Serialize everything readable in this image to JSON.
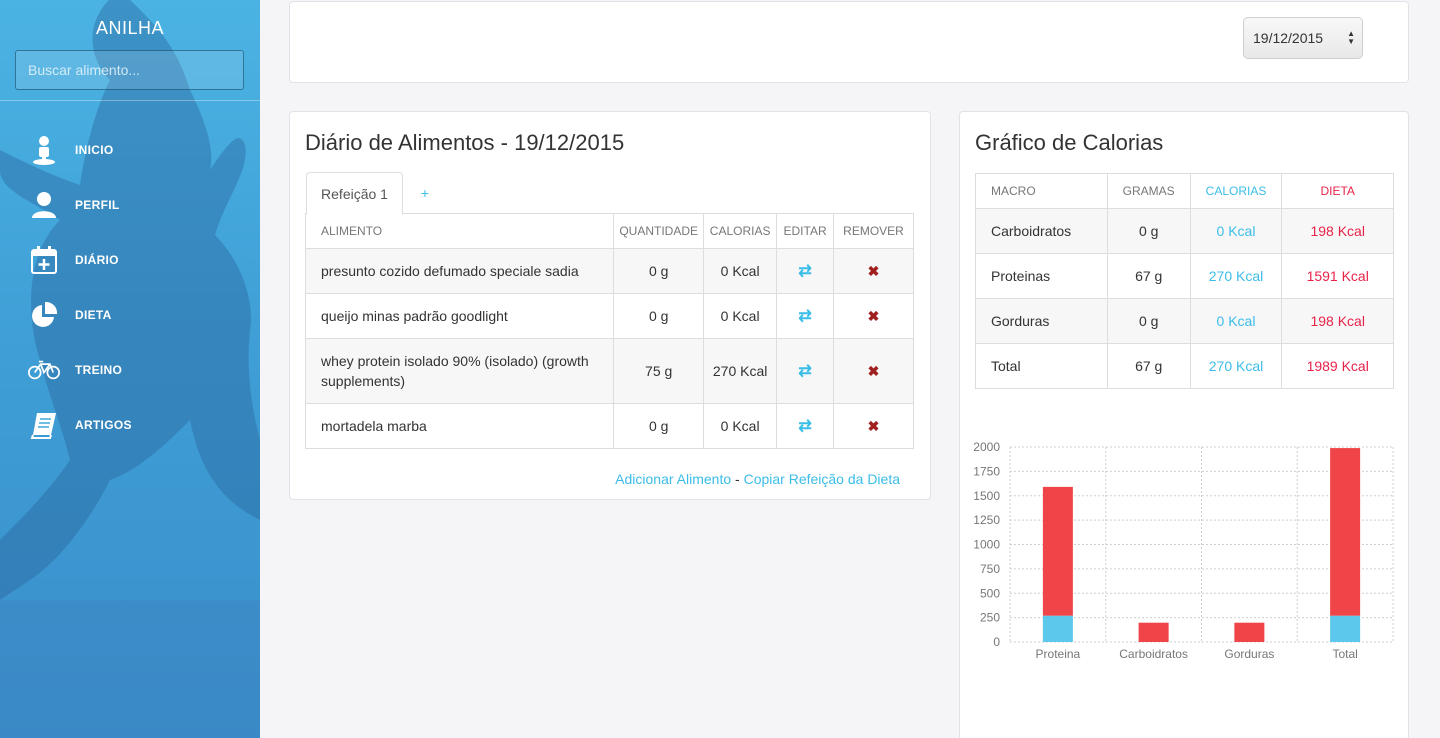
{
  "sidebar": {
    "brand": "ANILHA",
    "search_placeholder": "Buscar alimento...",
    "items": [
      {
        "label": "INICIO",
        "icon": "person-pin-icon"
      },
      {
        "label": "PERFIL",
        "icon": "user-icon"
      },
      {
        "label": "DIÁRIO",
        "icon": "calendar-add-icon"
      },
      {
        "label": "DIETA",
        "icon": "pie-chart-icon"
      },
      {
        "label": "TREINO",
        "icon": "bicycle-icon"
      },
      {
        "label": "ARTIGOS",
        "icon": "book-icon"
      }
    ]
  },
  "header": {
    "date_value": "19/12/2015"
  },
  "diary": {
    "title": "Diário de Alimentos - 19/12/2015",
    "tab_label": "Refeição 1",
    "tab_add": "+",
    "columns": [
      "ALIMENTO",
      "QUANTIDADE",
      "CALORIAS",
      "EDITAR",
      "REMOVER"
    ],
    "rows": [
      {
        "food": "presunto cozido defumado speciale sadia",
        "qty": "0 g",
        "cal": "0 Kcal"
      },
      {
        "food": "queijo minas padrão goodlight",
        "qty": "0 g",
        "cal": "0 Kcal"
      },
      {
        "food": "whey protein isolado 90% (isolado) (growth supplements)",
        "qty": "75 g",
        "cal": "270 Kcal"
      },
      {
        "food": "mortadela marba",
        "qty": "0 g",
        "cal": "0 Kcal"
      }
    ],
    "add_food_link": "Adicionar Alimento",
    "separator": "-",
    "copy_meal_link": "Copiar Refeição da Dieta"
  },
  "calories": {
    "title": "Gráfico de Calorias",
    "columns": [
      "MACRO",
      "GRAMAS",
      "CALORIAS",
      "DIETA"
    ],
    "rows": [
      {
        "macro": "Carboidratos",
        "grams": "0 g",
        "cal": "0 Kcal",
        "diet": "198 Kcal"
      },
      {
        "macro": "Proteinas",
        "grams": "67 g",
        "cal": "270 Kcal",
        "diet": "1591 Kcal"
      },
      {
        "macro": "Gorduras",
        "grams": "0 g",
        "cal": "0 Kcal",
        "diet": "198 Kcal"
      },
      {
        "macro": "Total",
        "grams": "67 g",
        "cal": "270 Kcal",
        "diet": "1989 Kcal"
      }
    ]
  },
  "chart_data": {
    "type": "bar",
    "stacked": true,
    "categories": [
      "Proteina",
      "Carboidratos",
      "Gorduras",
      "Total"
    ],
    "series": [
      {
        "color": "#5bc8ec",
        "values": [
          270,
          0,
          0,
          270
        ]
      },
      {
        "color": "#ef4549",
        "values": [
          1321,
          198,
          198,
          1719
        ]
      }
    ],
    "ylim": [
      0,
      2000
    ],
    "yticks": [
      0,
      250,
      500,
      750,
      1000,
      1250,
      1500,
      1750,
      2000
    ],
    "grid": true
  },
  "colors": {
    "accent": "#3bbde8",
    "danger": "#e8234a",
    "sidebar": "#42a8dc"
  }
}
